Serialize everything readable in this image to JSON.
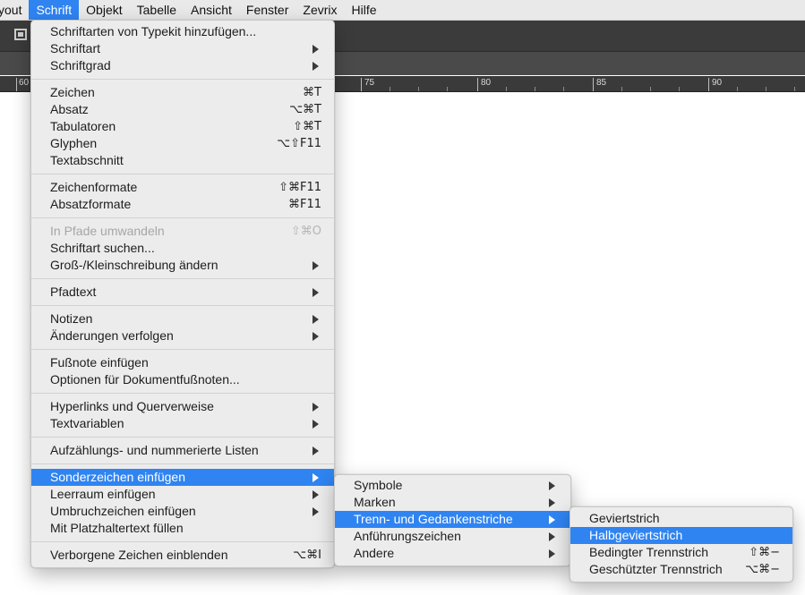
{
  "menubar": {
    "items": [
      "yout",
      "Schrift",
      "Objekt",
      "Tabelle",
      "Ansicht",
      "Fenster",
      "Zevrix",
      "Hilfe"
    ],
    "active": "Schrift"
  },
  "ruler": {
    "labels": [
      "60",
      "75",
      "80",
      "85",
      "90"
    ]
  },
  "schrift_menu": {
    "add_typekit": "Schriftarten von Typekit hinzufügen...",
    "schriftart": "Schriftart",
    "schriftgrad": "Schriftgrad",
    "zeichen": {
      "label": "Zeichen",
      "shortcut": "⌘T"
    },
    "absatz": {
      "label": "Absatz",
      "shortcut": "⌥⌘T"
    },
    "tabulatoren": {
      "label": "Tabulatoren",
      "shortcut": "⇧⌘T"
    },
    "glyphen": {
      "label": "Glyphen",
      "shortcut": "⌥⇧F11"
    },
    "textabschnitt": "Textabschnitt",
    "zeichenformate": {
      "label": "Zeichenformate",
      "shortcut": "⇧⌘F11"
    },
    "absatzformate": {
      "label": "Absatzformate",
      "shortcut": "⌘F11"
    },
    "in_pfade": {
      "label": "In Pfade umwandeln",
      "shortcut": "⇧⌘O"
    },
    "schriftart_suchen": "Schriftart suchen...",
    "gross_klein": "Groß-/Kleinschreibung ändern",
    "pfadtext": "Pfadtext",
    "notizen": "Notizen",
    "aenderungen": "Änderungen verfolgen",
    "fussnote": "Fußnote einfügen",
    "fussnote_optionen": "Optionen für Dokumentfußnoten...",
    "hyperlinks": "Hyperlinks und Querverweise",
    "textvariablen": "Textvariablen",
    "listen": "Aufzählungs- und nummerierte Listen",
    "sonderzeichen": "Sonderzeichen einfügen",
    "leerraum": "Leerraum einfügen",
    "umbruch": "Umbruchzeichen einfügen",
    "platzhalter": "Mit Platzhaltertext füllen",
    "verborgene": {
      "label": "Verborgene Zeichen einblenden",
      "shortcut": "⌥⌘I"
    }
  },
  "sonder_menu": {
    "symbole": "Symbole",
    "marken": "Marken",
    "trenn": "Trenn- und Gedankenstriche",
    "anfuehrung": "Anführungszeichen",
    "andere": "Andere"
  },
  "trenn_menu": {
    "geviertstrich": "Geviertstrich",
    "halbgeviertstrich": "Halbgeviertstrich",
    "bedingter": {
      "label": "Bedingter Trennstrich",
      "shortcut": "⇧⌘−"
    },
    "geschuetzter": {
      "label": "Geschützter Trennstrich",
      "shortcut": "⌥⌘−"
    }
  },
  "colors": {
    "highlight": "#2f84f1",
    "menu_bg": "#ececec",
    "toolbar_dark": "#3b3b3b"
  }
}
